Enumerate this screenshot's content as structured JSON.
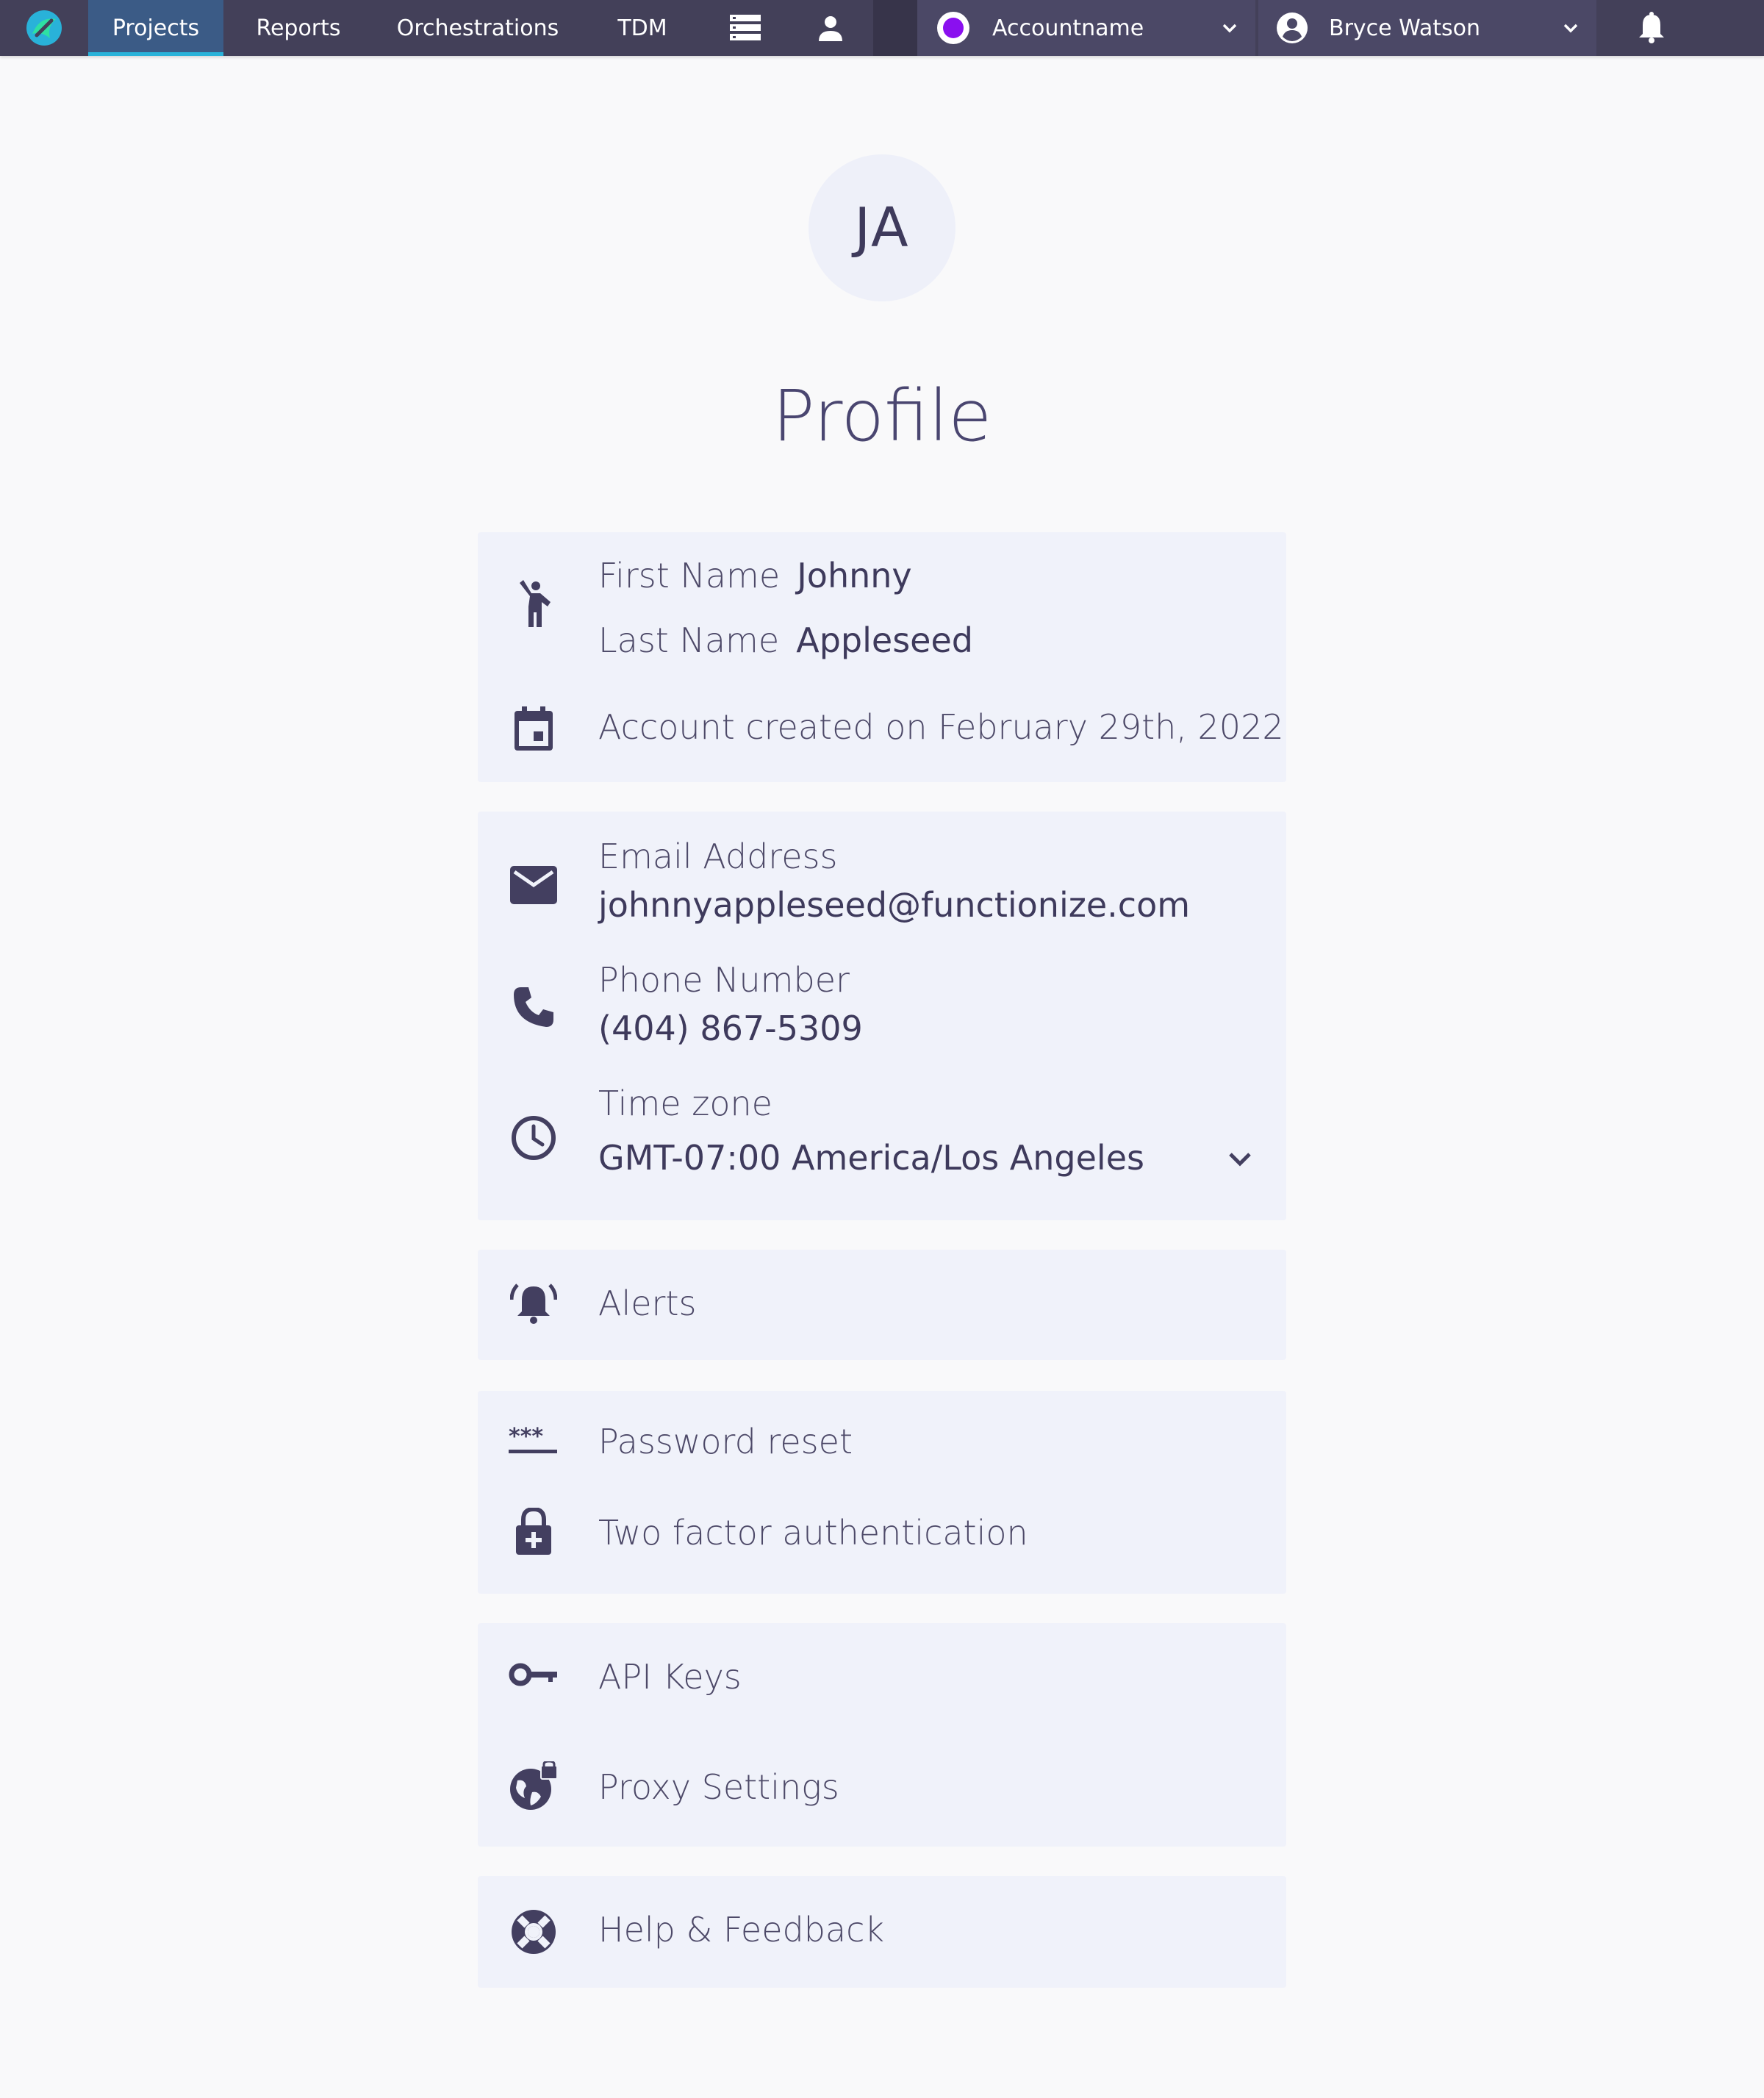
{
  "nav": {
    "tabs": [
      {
        "label": "Projects",
        "active": true
      },
      {
        "label": "Reports"
      },
      {
        "label": "Orchestrations"
      },
      {
        "label": "TDM"
      }
    ],
    "icons": [
      "logo-icon",
      "list-icon",
      "person-icon",
      "account-dot-icon",
      "user-circle-icon",
      "chevron-down-icon",
      "bell-icon"
    ],
    "account_name": "Accountname",
    "user_name": "Bryce Watson",
    "accent_color": "#29b2d9",
    "bar_color": "#434059",
    "account_dot_color": "#8a10ef"
  },
  "avatar": {
    "initials": "JA"
  },
  "page": {
    "title": "Profile"
  },
  "identity": {
    "first_name_label": "First Name",
    "first_name": "Johnny",
    "last_name_label": "Last Name",
    "last_name": "Appleseed",
    "created": "Account created on February 29th, 2022"
  },
  "contact": {
    "email_label": "Email Address",
    "email": "johnnyappleseed@functionize.com",
    "phone_label": "Phone Number",
    "phone": "(404) 867-5309",
    "timezone_label": "Time zone",
    "timezone": "GMT-07:00 America/Los Angeles"
  },
  "alerts": {
    "label": "Alerts"
  },
  "security": {
    "password_reset": "Password reset",
    "two_factor": "Two factor authentication"
  },
  "developer": {
    "api_keys": "API Keys",
    "proxy_settings": "Proxy Settings"
  },
  "help": {
    "label": "Help & Feedback"
  }
}
